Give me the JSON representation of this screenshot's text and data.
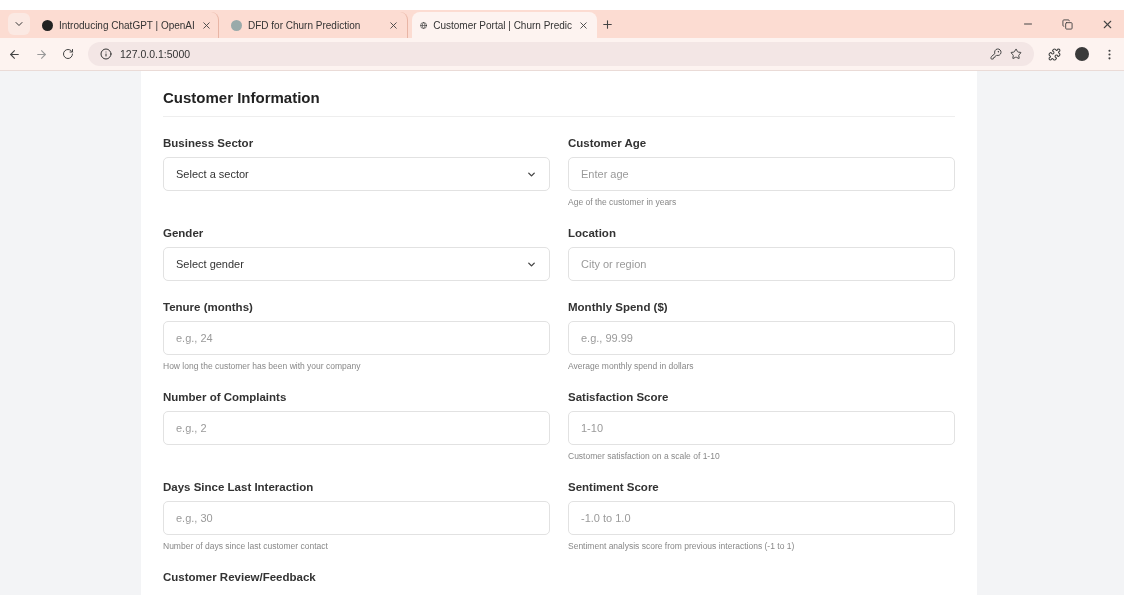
{
  "browser": {
    "tabs": [
      {
        "title": "Introducing ChatGPT | OpenAI",
        "selected": false
      },
      {
        "title": "DFD for Churn Prediction",
        "selected": false
      },
      {
        "title": "Customer Portal | Churn Predic",
        "selected": true
      }
    ],
    "address": "127.0.0.1:5000"
  },
  "form": {
    "title": "Customer Information",
    "rows": [
      [
        {
          "kind": "select",
          "label": "Business Sector",
          "placeholder": "Select a sector"
        },
        {
          "kind": "input",
          "label": "Customer Age",
          "placeholder": "Enter age",
          "help": "Age of the customer in years"
        }
      ],
      [
        {
          "kind": "select",
          "label": "Gender",
          "placeholder": "Select gender"
        },
        {
          "kind": "input",
          "label": "Location",
          "placeholder": "City or region"
        }
      ],
      [
        {
          "kind": "input",
          "label": "Tenure (months)",
          "placeholder": "e.g., 24",
          "help": "How long the customer has been with your company"
        },
        {
          "kind": "input",
          "label": "Monthly Spend ($)",
          "placeholder": "e.g., 99.99",
          "help": "Average monthly spend in dollars"
        }
      ],
      [
        {
          "kind": "input",
          "label": "Number of Complaints",
          "placeholder": "e.g., 2"
        },
        {
          "kind": "input",
          "label": "Satisfaction Score",
          "placeholder": "1-10",
          "help": "Customer satisfaction on a scale of 1-10"
        }
      ],
      [
        {
          "kind": "input",
          "label": "Days Since Last Interaction",
          "placeholder": "e.g., 30",
          "help": "Number of days since last customer contact"
        },
        {
          "kind": "input",
          "label": "Sentiment Score",
          "placeholder": "-1.0 to 1.0",
          "help": "Sentiment analysis score from previous interactions (-1 to 1)"
        }
      ]
    ],
    "review_label": "Customer Review/Feedback"
  }
}
